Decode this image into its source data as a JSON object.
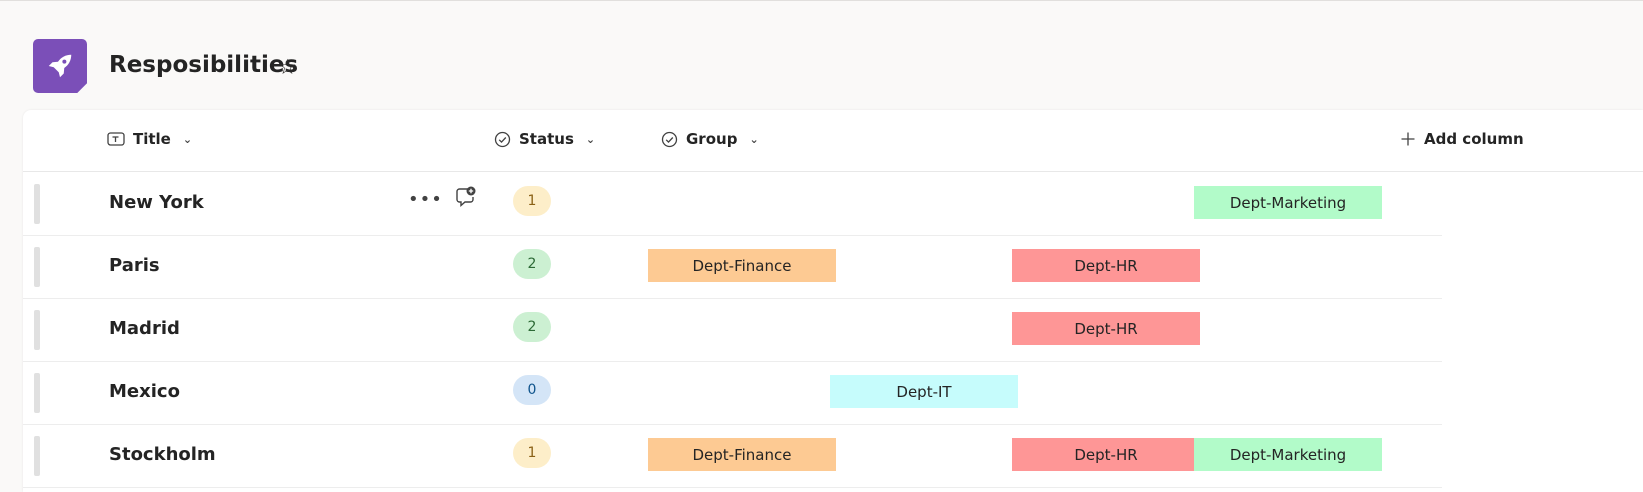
{
  "page": {
    "title": "Resposibilities",
    "app_icon": "rocket-icon",
    "favorite_icon": "star-icon",
    "accent_color": "#7b4fb8"
  },
  "columns": [
    {
      "label": "Title",
      "icon": "text-field-icon"
    },
    {
      "label": "Status",
      "icon": "check-circle-icon"
    },
    {
      "label": "Group",
      "icon": "check-circle-icon"
    },
    {
      "label": "Add column",
      "icon": "plus-icon"
    }
  ],
  "group_colors": {
    "Dept-Finance": "#fdca93",
    "Dept-IT": "#c6fcfc",
    "Dept-HR": "#fe9696",
    "Dept-Marketing": "#b2fbc9"
  },
  "status_colors": {
    "0": {
      "bg": "#d4e5f7",
      "fg": "#0f548c"
    },
    "1": {
      "bg": "#fdeec9",
      "fg": "#8a6116"
    },
    "2": {
      "bg": "#ccf0d2",
      "fg": "#2d6a36"
    }
  },
  "row_action_icons": [
    "more-options-icon",
    "add-comment-icon"
  ],
  "rows": [
    {
      "title": "New York",
      "status": "1",
      "groups": [
        "Dept-Marketing"
      ]
    },
    {
      "title": "Paris",
      "status": "2",
      "groups": [
        "Dept-Finance",
        "Dept-HR"
      ]
    },
    {
      "title": "Madrid",
      "status": "2",
      "groups": [
        "Dept-HR"
      ]
    },
    {
      "title": "Mexico",
      "status": "0",
      "groups": [
        "Dept-IT"
      ]
    },
    {
      "title": "Stockholm",
      "status": "1",
      "groups": [
        "Dept-Finance",
        "Dept-HR",
        "Dept-Marketing"
      ]
    }
  ]
}
